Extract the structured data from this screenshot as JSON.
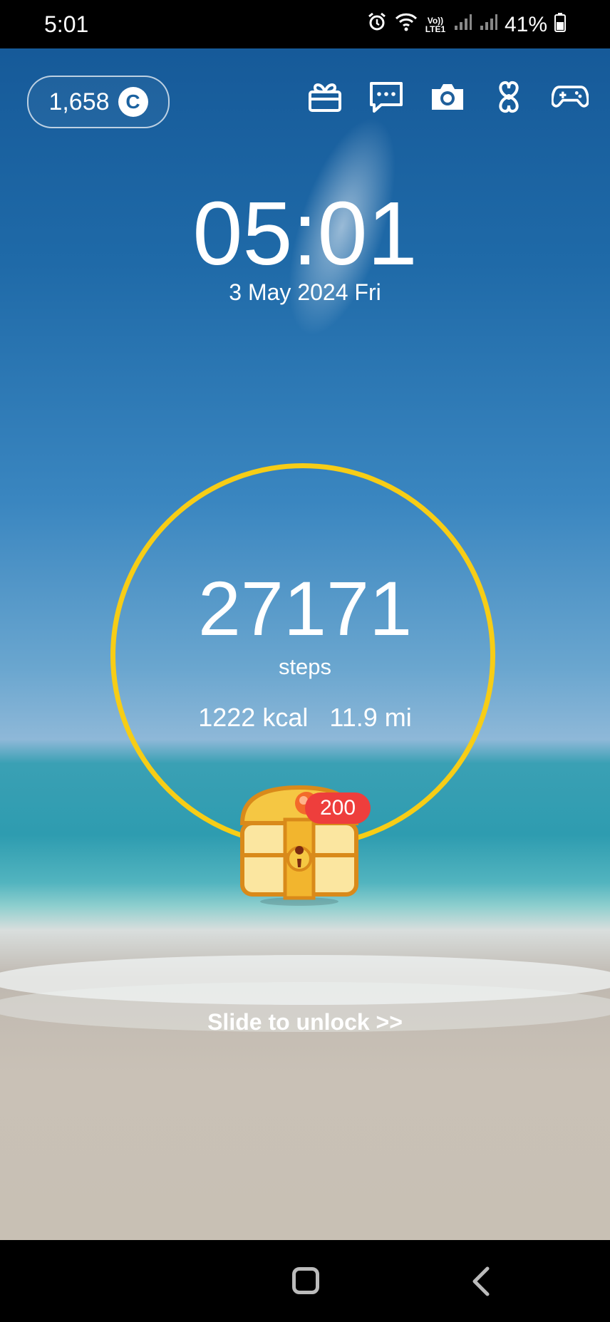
{
  "status_bar": {
    "time": "5:01",
    "network": "Vo)) LTE1",
    "battery": "41%"
  },
  "coins": {
    "amount": "1,658",
    "icon_letter": "C"
  },
  "toolbar": {
    "icons": [
      "gift-icon",
      "chat-icon",
      "camera-icon",
      "clover-icon",
      "gamepad-icon"
    ]
  },
  "lockscreen": {
    "clock": "05:01",
    "date": "3 May 2024 Fri"
  },
  "pedometer": {
    "steps": "27171",
    "steps_label": "steps",
    "kcal": "1222 kcal",
    "distance": "11.9 mi",
    "ring_color": "#f7cd16"
  },
  "reward": {
    "badge": "200",
    "badge_color": "#ee3e3c"
  },
  "unlock": {
    "label": "Slide to unlock >>"
  }
}
